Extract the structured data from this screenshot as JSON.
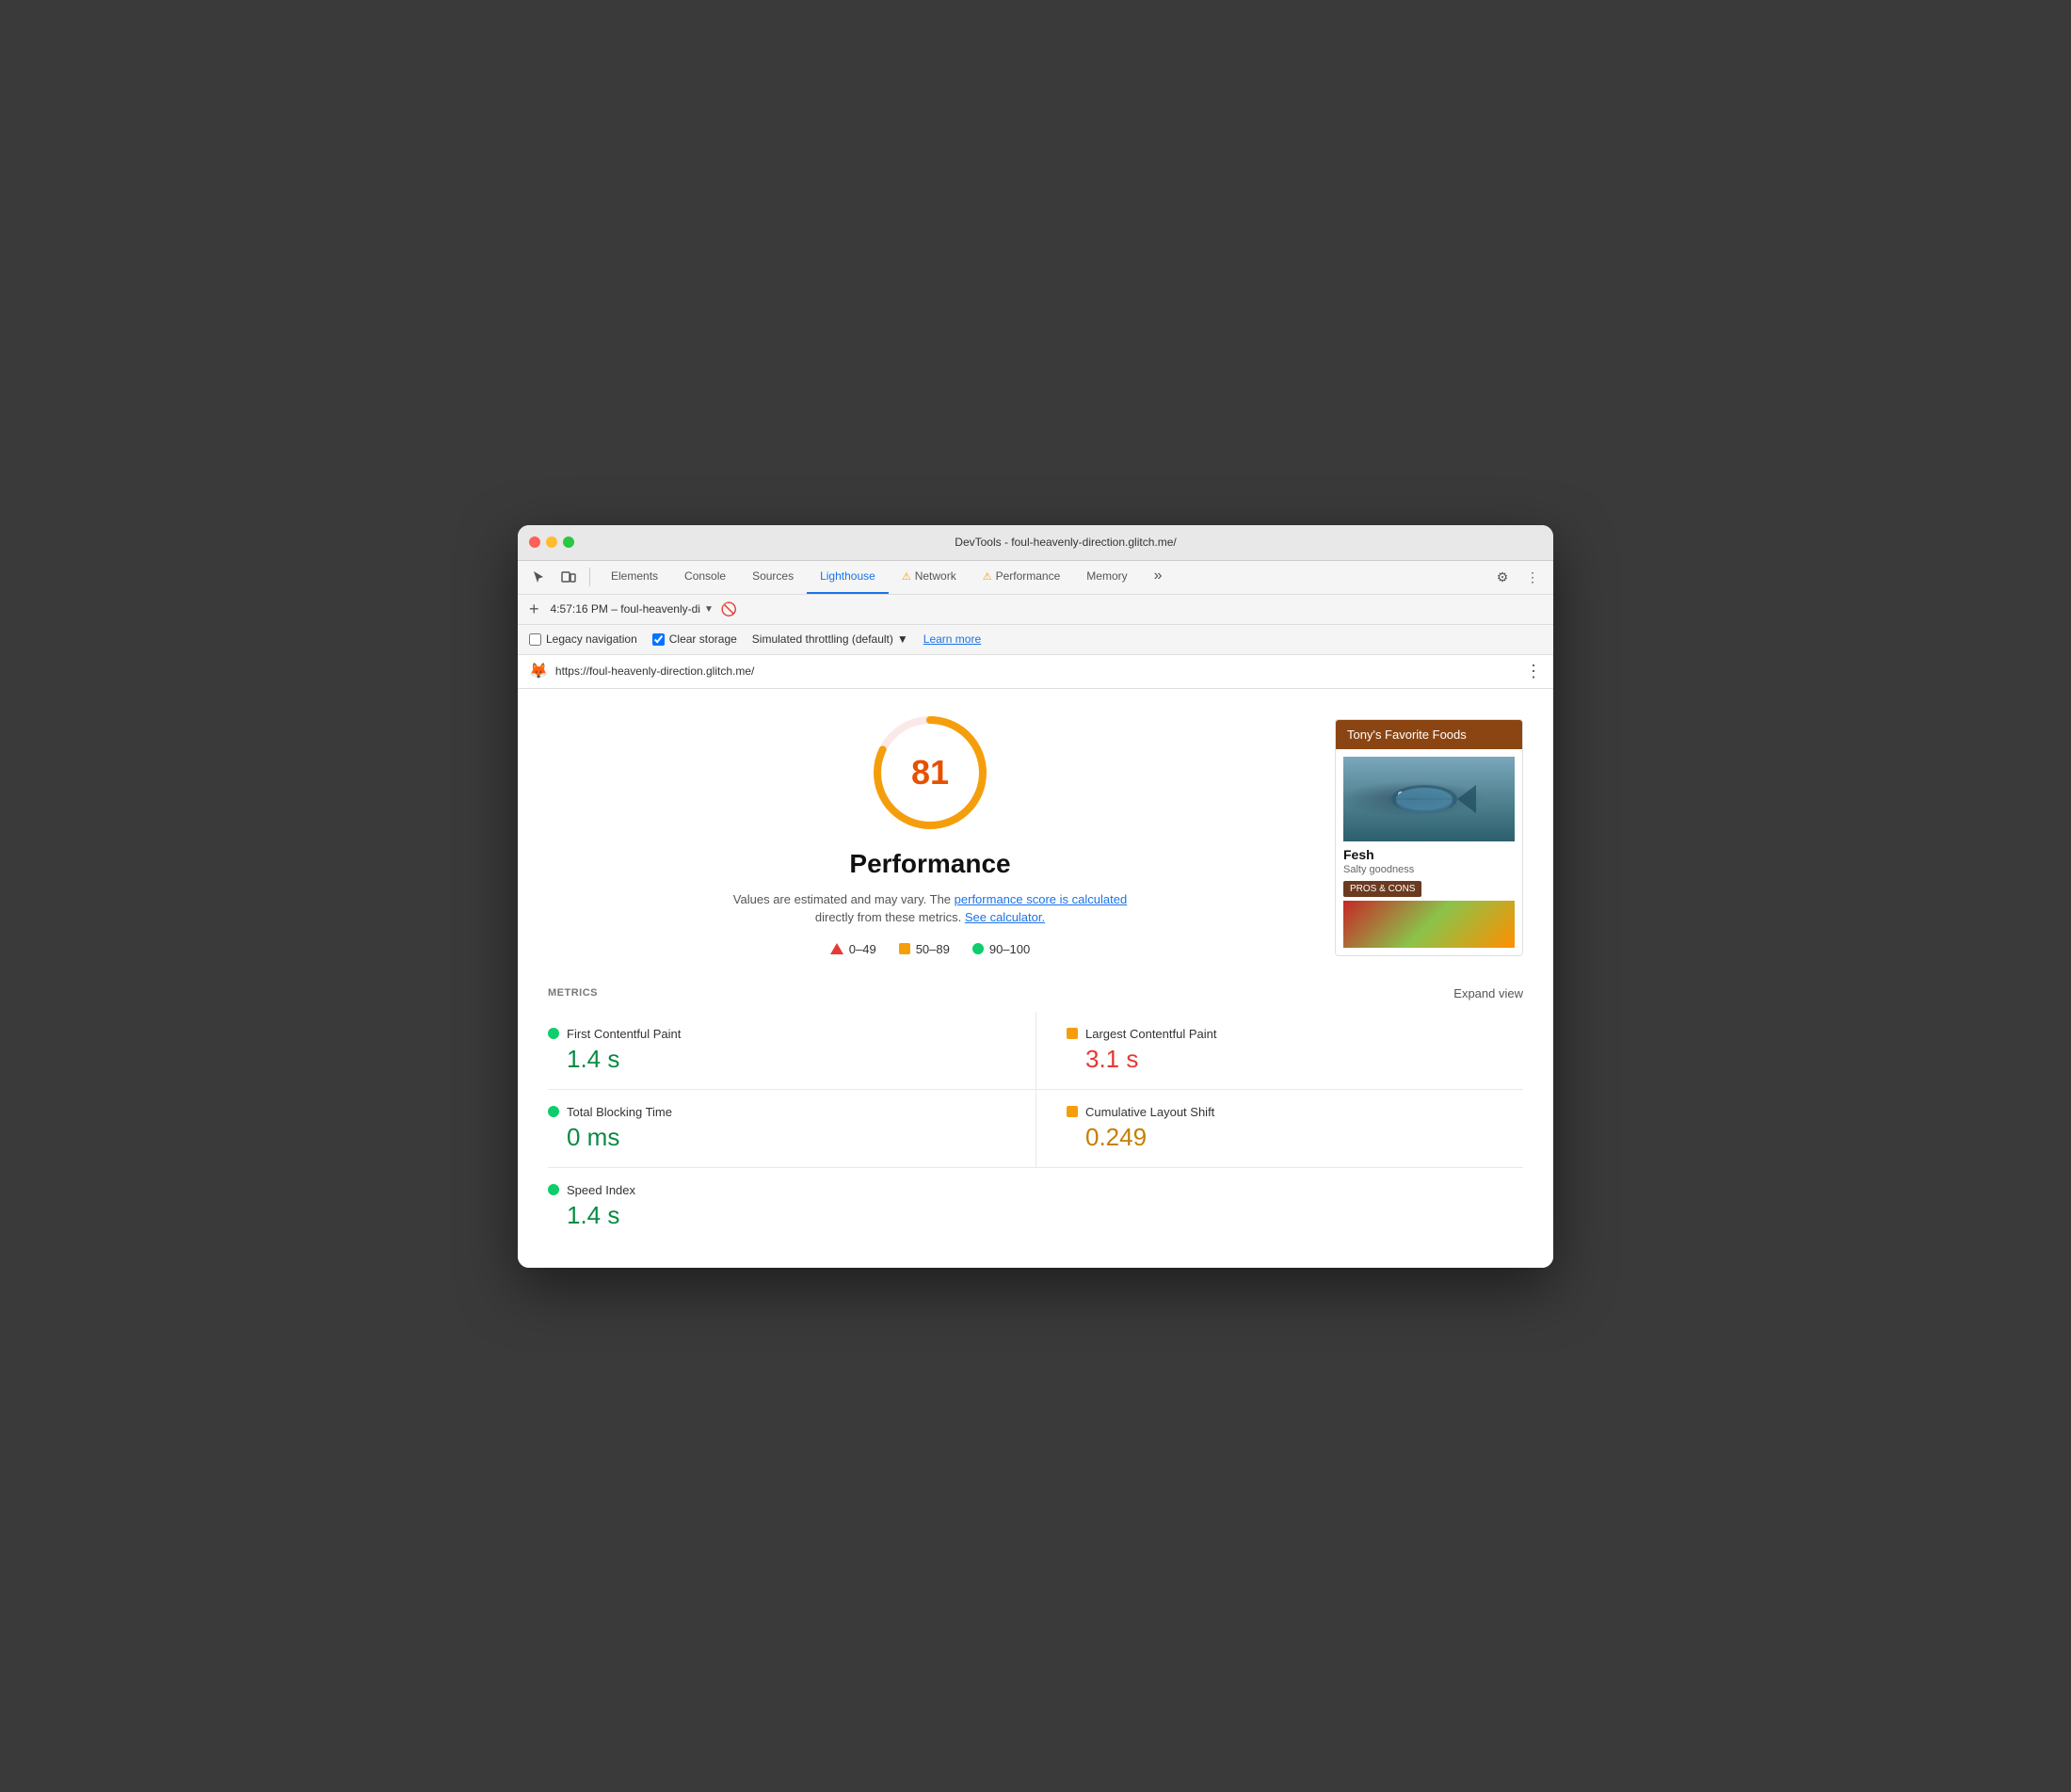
{
  "window": {
    "title": "DevTools - foul-heavenly-direction.glitch.me/"
  },
  "tabs": {
    "items": [
      {
        "label": "Elements",
        "active": false,
        "warning": false
      },
      {
        "label": "Console",
        "active": false,
        "warning": false
      },
      {
        "label": "Sources",
        "active": false,
        "warning": false
      },
      {
        "label": "Lighthouse",
        "active": true,
        "warning": false
      },
      {
        "label": "Network",
        "active": false,
        "warning": true
      },
      {
        "label": "Performance",
        "active": false,
        "warning": true
      },
      {
        "label": "Memory",
        "active": false,
        "warning": false
      }
    ],
    "more_label": "»"
  },
  "secondary_toolbar": {
    "session_label": "4:57:16 PM – foul-heavenly-di",
    "add_label": "+"
  },
  "options": {
    "legacy_nav_label": "Legacy navigation",
    "legacy_nav_checked": false,
    "clear_storage_label": "Clear storage",
    "clear_storage_checked": true,
    "throttle_label": "Simulated throttling (default)",
    "learn_more_label": "Learn more"
  },
  "url_bar": {
    "url": "https://foul-heavenly-direction.glitch.me/"
  },
  "score": {
    "value": "81",
    "title": "Performance",
    "description_start": "Values are estimated and may vary. The",
    "perf_score_link": "performance score is calculated",
    "description_mid": "directly from these metrics.",
    "calculator_link": "See calculator.",
    "score_circle_color": "#e65100",
    "score_track_color": "#fbe9e7"
  },
  "legend": {
    "items": [
      {
        "icon": "triangle",
        "range": "0–49"
      },
      {
        "icon": "square",
        "range": "50–89"
      },
      {
        "icon": "circle",
        "range": "90–100"
      }
    ]
  },
  "preview_card": {
    "header": "Tony's Favorite Foods",
    "food_name": "Fesh",
    "food_desc": "Salty goodness",
    "pros_cons_btn": "PROS & CONS"
  },
  "metrics": {
    "section_title": "METRICS",
    "expand_view_label": "Expand view",
    "items": [
      {
        "label": "First Contentful Paint",
        "value": "1.4 s",
        "color": "green",
        "icon": "circle"
      },
      {
        "label": "Largest Contentful Paint",
        "value": "3.1 s",
        "color": "red",
        "icon": "square"
      },
      {
        "label": "Total Blocking Time",
        "value": "0 ms",
        "color": "green",
        "icon": "circle"
      },
      {
        "label": "Cumulative Layout Shift",
        "value": "0.249",
        "color": "orange",
        "icon": "square"
      },
      {
        "label": "Speed Index",
        "value": "1.4 s",
        "color": "green",
        "icon": "circle"
      }
    ]
  }
}
